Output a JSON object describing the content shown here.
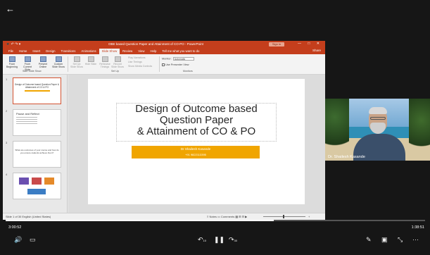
{
  "player": {
    "back_icon": "back-arrow-icon",
    "elapsed": "3:00:52",
    "total": "1:38:51",
    "progress_fraction": 0.64
  },
  "powerpoint": {
    "quick_access": "◾ ↶ ↷ ▾",
    "doc_title": "OBE based Question Paper and Attainment of CO-PO - PowerPoint",
    "sign_in": "Sign in",
    "window_controls": "— □ ✕",
    "tabs": [
      "File",
      "Home",
      "Insert",
      "Design",
      "Transitions",
      "Animations",
      "Slide Show",
      "Review",
      "View",
      "Help",
      "Tell me what you want to do"
    ],
    "active_tab_index": 6,
    "share": "Share",
    "ribbon": {
      "buttons": [
        {
          "label": "From Beginning",
          "dim": false
        },
        {
          "label": "From Current Slide",
          "dim": false
        },
        {
          "label": "Present Online",
          "dim": false
        },
        {
          "label": "Custom Slide Show",
          "dim": false
        },
        {
          "label": "Set Up Slide Show",
          "dim": true
        },
        {
          "label": "Hide Slide",
          "dim": true
        },
        {
          "label": "Rehearse Timings",
          "dim": true
        },
        {
          "label": "Record Slide Show",
          "dim": true
        }
      ],
      "group_start": "Start Slide Show",
      "group_setup": "Set Up",
      "group_monitors": "Monitors",
      "setup_options": [
        "Play Narrations",
        "Use Timings",
        "Show Media Controls"
      ],
      "monitor_label": "Monitor:",
      "monitor_value": "Automatic",
      "presenter_view": "Use Presenter View"
    },
    "thumbnails": {
      "slide1_text": "Design of Outcome based Question Paper & Attainment of CO & PO",
      "slide2_title": "Pause and Reflect",
      "slide3_text": "What are outcomes of your course and how do you ensure students achieve them?",
      "numbers": [
        "1",
        "2",
        "3",
        "4"
      ]
    },
    "slide": {
      "title_lines": [
        "Design of Outcome based",
        "Question Paper",
        "& Attainment of CO & PO"
      ],
      "author": "Dr Shailesh Kasande",
      "contact": "+91 9822113395"
    },
    "statusbar": {
      "left": "Slide 1 of 30   English (United States)",
      "right": "≡ Notes   ▭ Comments   ▦   ⊞   ⊟   ▶",
      "zoom": "+"
    }
  },
  "speaker": {
    "name": "Dr. Shailesh Kasande"
  },
  "controls": {
    "volume_icon": "🔊",
    "captions_icon": "▭",
    "rewind_label": "↶",
    "rewind_sub": "10",
    "pause_label": "❚❚",
    "forward_label": "↷",
    "forward_sub": "30",
    "edit_icon": "✎",
    "subtitle_icon": "▣",
    "fullscreen_icon": "⤡",
    "more_icon": "···"
  }
}
